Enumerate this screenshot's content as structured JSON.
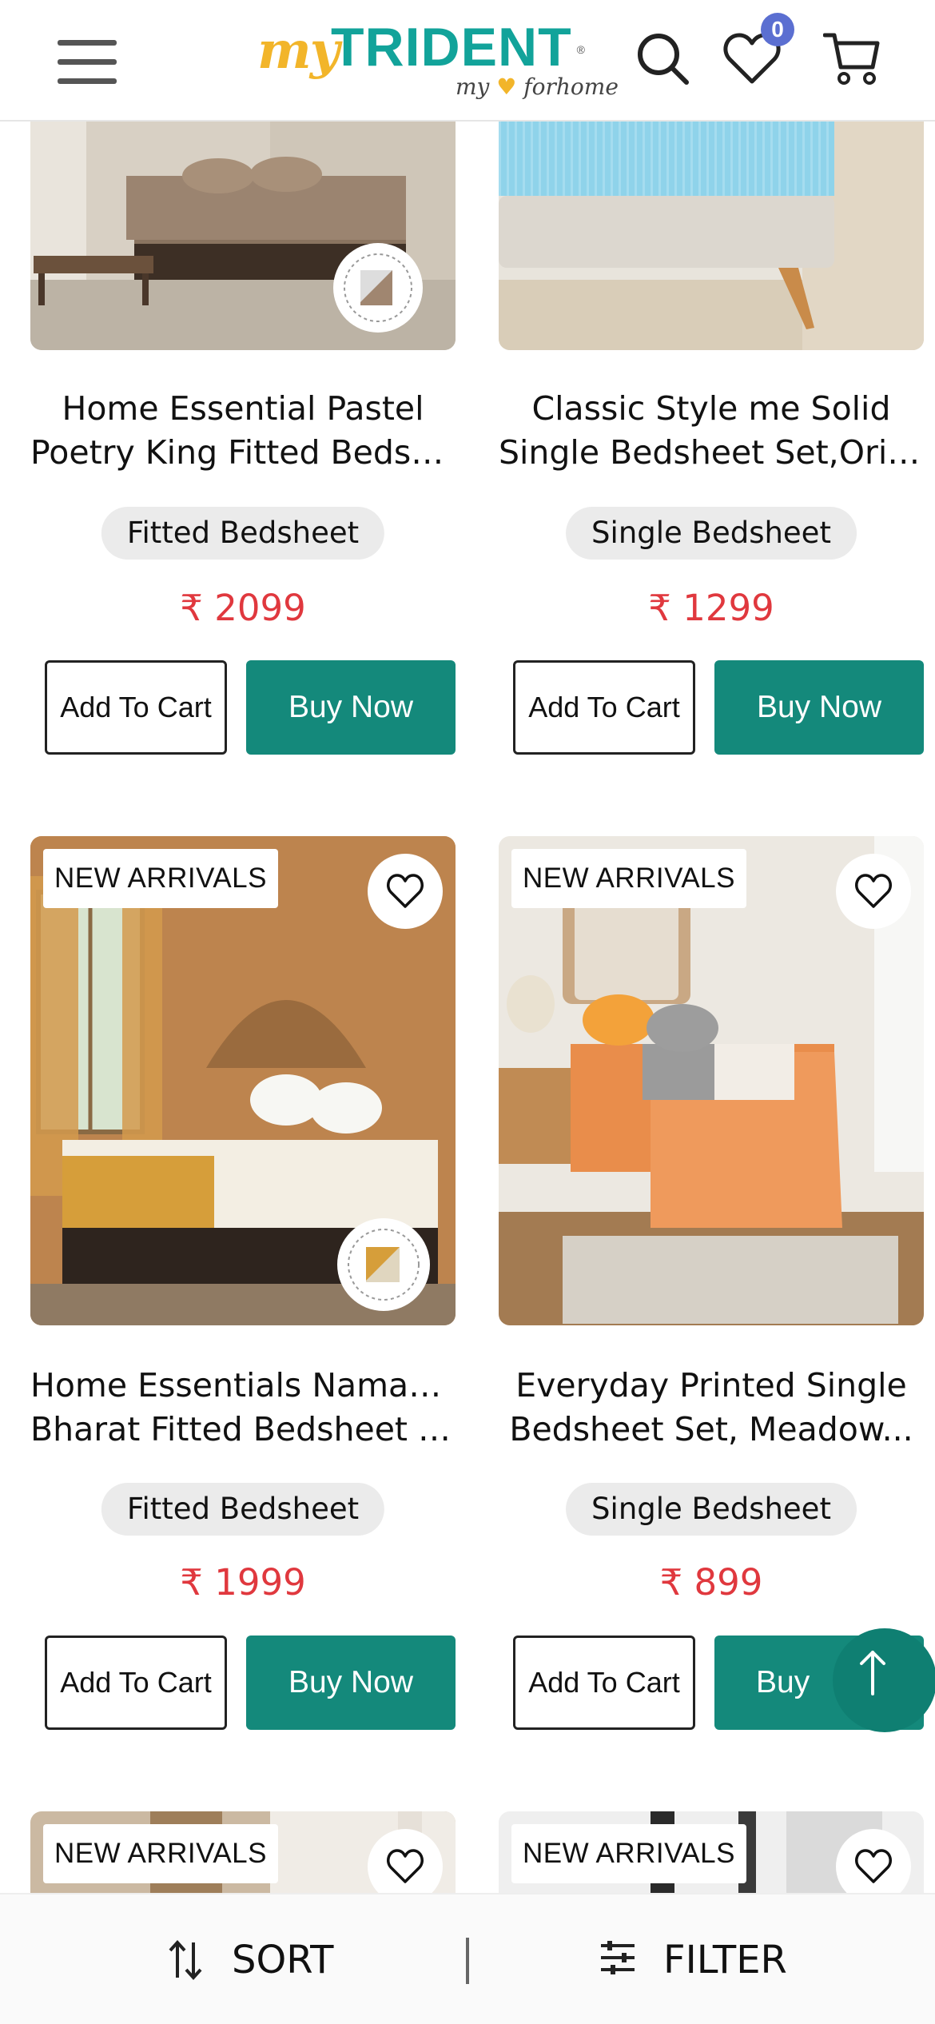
{
  "header": {
    "logo_my": "my",
    "logo_brand": "TRIDENT",
    "logo_reg": "®",
    "logo_tag_a": "my",
    "logo_tag_b": "forhome",
    "wishlist_count": "0",
    "icons": [
      "menu-icon",
      "search-icon",
      "heart-icon",
      "cart-icon"
    ]
  },
  "colors": {
    "brand_teal": "#14897b",
    "price_red": "#e0383e",
    "badge_blue": "#5b6fd1",
    "logo_yellow": "#f2b52a"
  },
  "products": [
    {
      "title_line1": "Home Essential Pastel",
      "title_line2": "Poetry King Fitted Bedshe...",
      "category": "Fitted Bedsheet",
      "price": "₹ 2099",
      "add_to_cart": "Add To Cart",
      "buy_now": "Buy Now",
      "image_stamp": "FITTED BEDSHEET"
    },
    {
      "title_line1": "Classic Style me Solid",
      "title_line2": "Single Bedsheet Set,Orion...",
      "category": "Single Bedsheet",
      "price": "₹ 1299",
      "add_to_cart": "Add To Cart",
      "buy_now": "Buy Now"
    },
    {
      "badge": "NEW ARRIVALS",
      "title_line1": "Home Essentials Namaste",
      "title_line2": "Bharat Fitted Bedsheet Se...",
      "category": "Fitted Bedsheet",
      "price": "₹ 1999",
      "add_to_cart": "Add To Cart",
      "buy_now": "Buy Now",
      "image_stamp": "FITTED BEDSHEET"
    },
    {
      "badge": "NEW ARRIVALS",
      "title_line1": "Everyday Printed Single",
      "title_line2": "Bedsheet Set, Meadow...",
      "category": "Single Bedsheet",
      "price": "₹ 899",
      "add_to_cart": "Add To Cart",
      "buy_now": "Buy"
    },
    {
      "badge": "NEW ARRIVALS"
    },
    {
      "badge": "NEW ARRIVALS"
    }
  ],
  "bottom_bar": {
    "sort_label": "SORT",
    "filter_label": "FILTER"
  }
}
